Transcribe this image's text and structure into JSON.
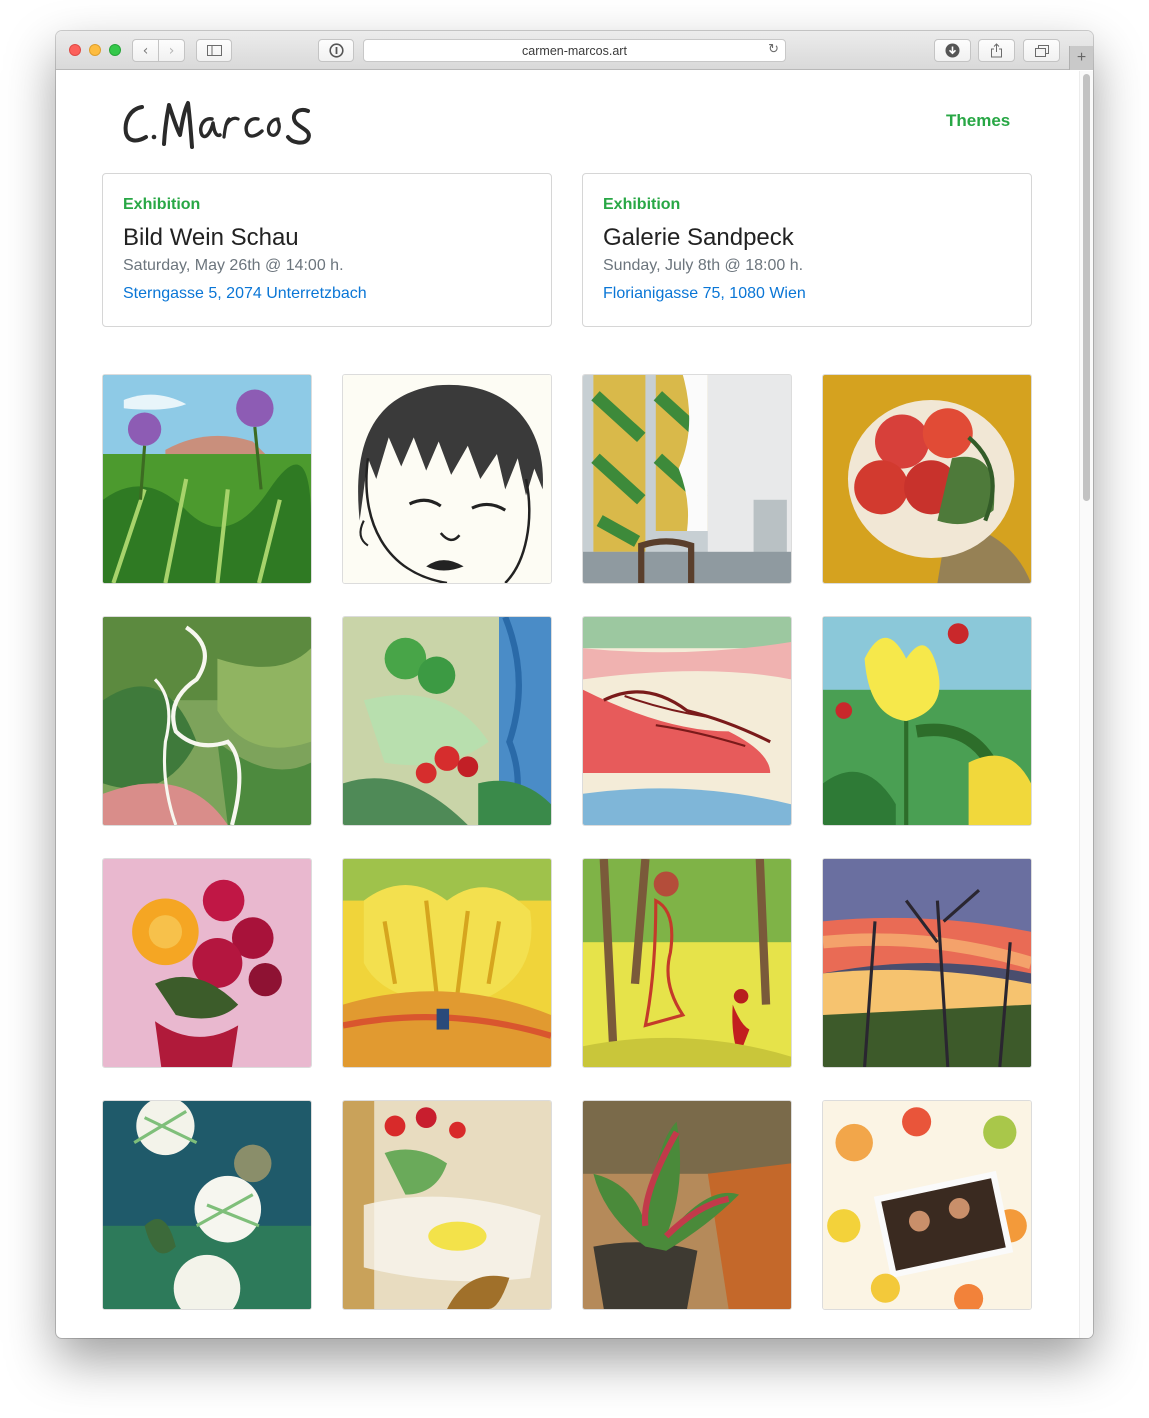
{
  "browser": {
    "url": "carmen-marcos.art"
  },
  "site": {
    "logo_text": "C.Marcos",
    "nav_themes": "Themes"
  },
  "events": [
    {
      "kind": "Exhibition",
      "title": "Bild Wein Schau",
      "date": "Saturday, May 26th @ 14:00 h.",
      "address": "Sterngasse 5, 2074 Unterretzbach"
    },
    {
      "kind": "Exhibition",
      "title": "Galerie Sandpeck",
      "date": "Sunday, July 8th @ 18:00 h.",
      "address": "Florianigasse 75, 1080 Wien"
    }
  ],
  "colors": {
    "accent_green": "#28a745",
    "link_blue": "#0a76d6",
    "muted_gray": "#6c757d"
  }
}
